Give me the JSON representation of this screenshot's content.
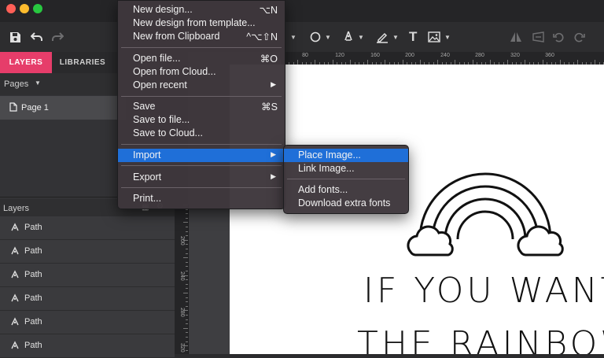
{
  "window": {
    "traffic_lights": [
      {
        "name": "close",
        "color": "#ff5f57"
      },
      {
        "name": "minimize",
        "color": "#febc2e"
      },
      {
        "name": "maximize",
        "color": "#28c840"
      }
    ]
  },
  "toolbar": {
    "icons": [
      "save-icon",
      "undo-icon",
      "redo-icon",
      "ellipse-tool-icon",
      "pen-tool-icon",
      "pencil-tool-icon",
      "text-tool-icon",
      "image-tool-icon",
      "flip-horizontal-icon",
      "flip-perspective-icon",
      "rotate-left-icon",
      "rotate-right-icon"
    ],
    "text_tool": "T"
  },
  "left_panel": {
    "tabs": [
      {
        "label": "LAYERS",
        "active": true
      },
      {
        "label": "LIBRARIES",
        "active": false
      }
    ],
    "pages_label": "Pages",
    "pages": [
      {
        "label": "Page 1"
      }
    ],
    "layers_label": "Layers",
    "layers": [
      {
        "label": "Path"
      },
      {
        "label": "Path"
      },
      {
        "label": "Path"
      },
      {
        "label": "Path"
      },
      {
        "label": "Path"
      },
      {
        "label": "Path"
      }
    ]
  },
  "rulers": {
    "horizontal": [
      "80",
      "120",
      "160",
      "200",
      "240",
      "280",
      "320",
      "360"
    ],
    "vertical": [
      "200",
      "240",
      "280",
      "320"
    ]
  },
  "artboard": {
    "line1": "IF YOU WANT",
    "line2": "THE RAINBOW"
  },
  "file_menu": {
    "items": [
      {
        "label": "New design...",
        "shortcut": "⌥N"
      },
      {
        "label": "New design from template...",
        "shortcut": ""
      },
      {
        "label": "New from Clipboard",
        "shortcut": "^⌥⇧N"
      },
      {
        "label": "Open file...",
        "shortcut": "⌘O"
      },
      {
        "label": "Open from Cloud...",
        "shortcut": ""
      },
      {
        "label": "Open recent",
        "shortcut": "▶"
      },
      {
        "label": "Save",
        "shortcut": "⌘S"
      },
      {
        "label": "Save to file...",
        "shortcut": ""
      },
      {
        "label": "Save to Cloud...",
        "shortcut": ""
      },
      {
        "label": "Import",
        "shortcut": "▶"
      },
      {
        "label": "Export",
        "shortcut": "▶"
      },
      {
        "label": "Print...",
        "shortcut": ""
      }
    ]
  },
  "import_submenu": {
    "items": [
      {
        "label": "Place Image..."
      },
      {
        "label": "Link Image..."
      },
      {
        "label": "Add fonts..."
      },
      {
        "label": "Download extra fonts"
      }
    ]
  },
  "colors": {
    "accent_tab": "#e63d6a",
    "menu_highlight": "#1f6fd8"
  }
}
